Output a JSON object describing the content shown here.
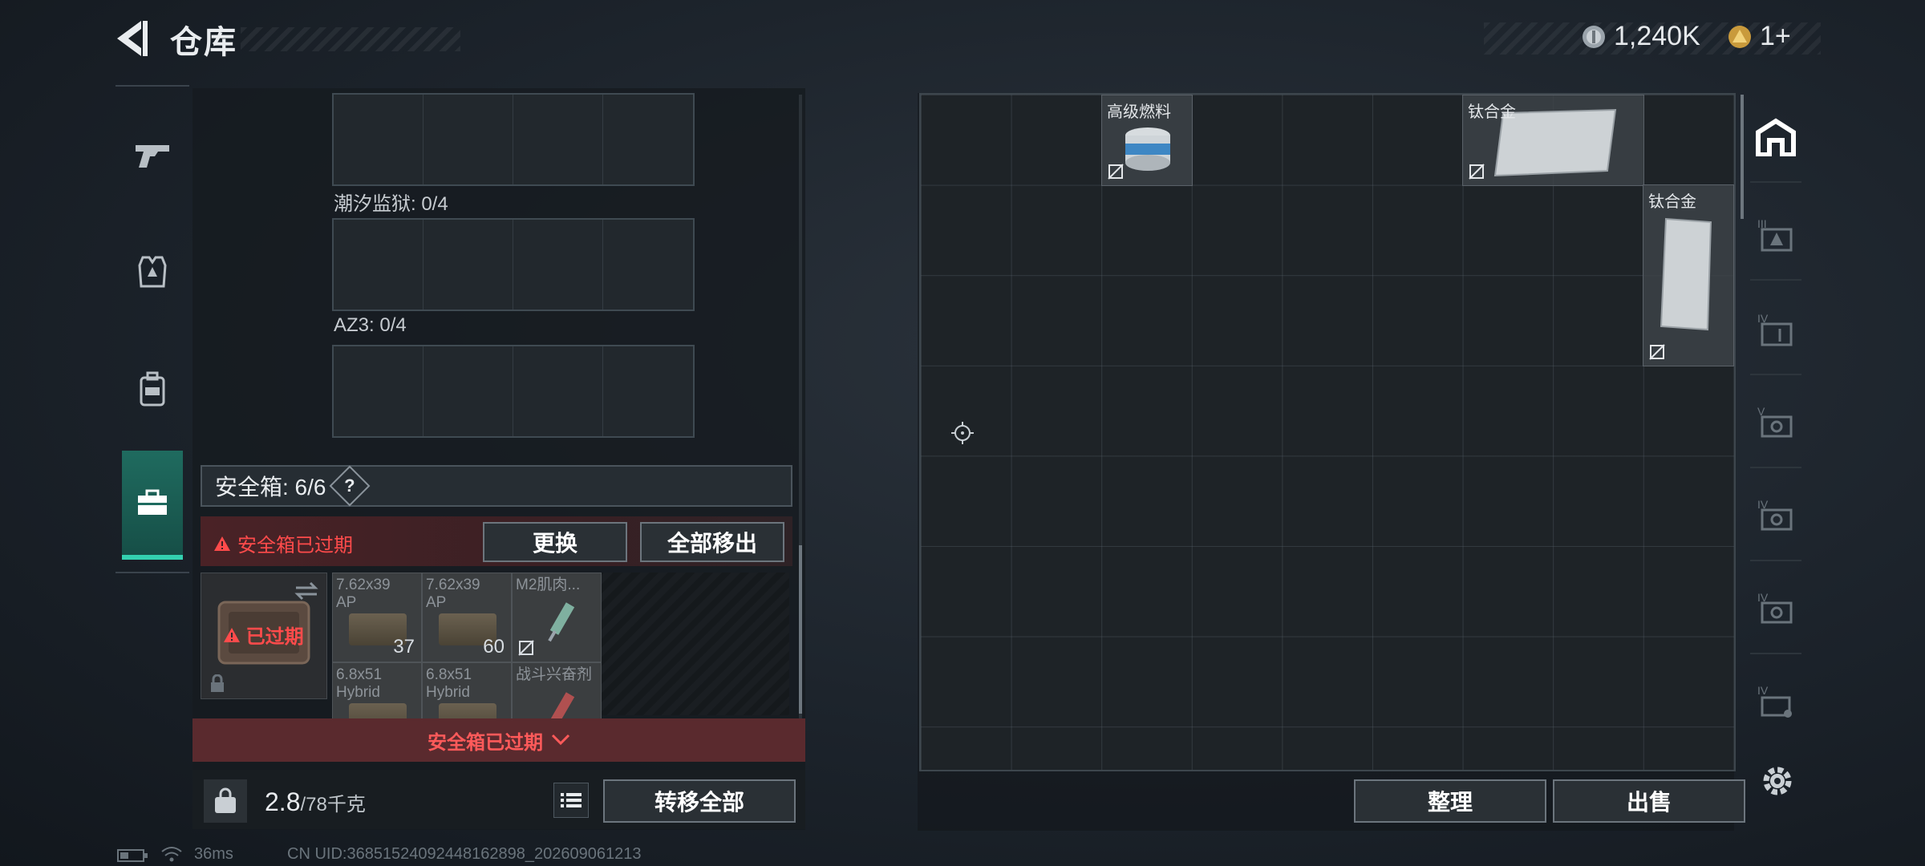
{
  "header": {
    "title": "仓库",
    "currency": [
      {
        "icon": "silver-coin-icon",
        "value": "1,240K"
      },
      {
        "icon": "gold-coin-icon",
        "value": "1+"
      }
    ]
  },
  "left_rail": [
    {
      "icon": "gun-icon",
      "active": false
    },
    {
      "icon": "armor-vest-icon",
      "active": false
    },
    {
      "icon": "backpack-icon",
      "active": false
    },
    {
      "icon": "toolbox-icon",
      "active": true
    }
  ],
  "containers": [
    {
      "label": ""
    },
    {
      "label": "潮汐监狱: 0/4"
    },
    {
      "label": "AZ3: 0/4"
    }
  ],
  "safe_box": {
    "title": "安全箱: 6/6",
    "help": "?",
    "expired_warning": "安全箱已过期",
    "replace_label": "更换",
    "move_all_label": "全部移出",
    "case_status": "已过期",
    "footer": "安全箱已过期",
    "items": [
      {
        "name": "7.62x39\nAP",
        "qty": "37"
      },
      {
        "name": "7.62x39\nAP",
        "qty": "60"
      },
      {
        "name": "M2肌肉...",
        "qty": ""
      },
      {
        "name": "6.8x51\nHybrid",
        "qty": ""
      },
      {
        "name": "6.8x51\nHybrid",
        "qty": ""
      },
      {
        "name": "战斗兴奋剂",
        "qty": ""
      }
    ]
  },
  "weight": {
    "current": "2.8",
    "capacity": "/78千克"
  },
  "buttons": {
    "transfer_all": "转移全部",
    "sort": "整理",
    "sell": "出售"
  },
  "stash_items": [
    {
      "name": "高级燃料"
    },
    {
      "name": "钛合金"
    },
    {
      "name": "钛合金"
    }
  ],
  "right_rail": [
    {
      "icon": "stash-home-icon"
    },
    {
      "icon": "tier-3-container-icon"
    },
    {
      "icon": "tier-4-container-icon"
    },
    {
      "icon": "tier-5-case-icon"
    },
    {
      "icon": "tier-4-case-icon"
    },
    {
      "icon": "tier-4-case-icon"
    },
    {
      "icon": "tier-4-key-icon"
    }
  ],
  "status_bar": {
    "ping": "36ms",
    "uid": "CN UID:3685152409244816289​8_202609061213"
  }
}
